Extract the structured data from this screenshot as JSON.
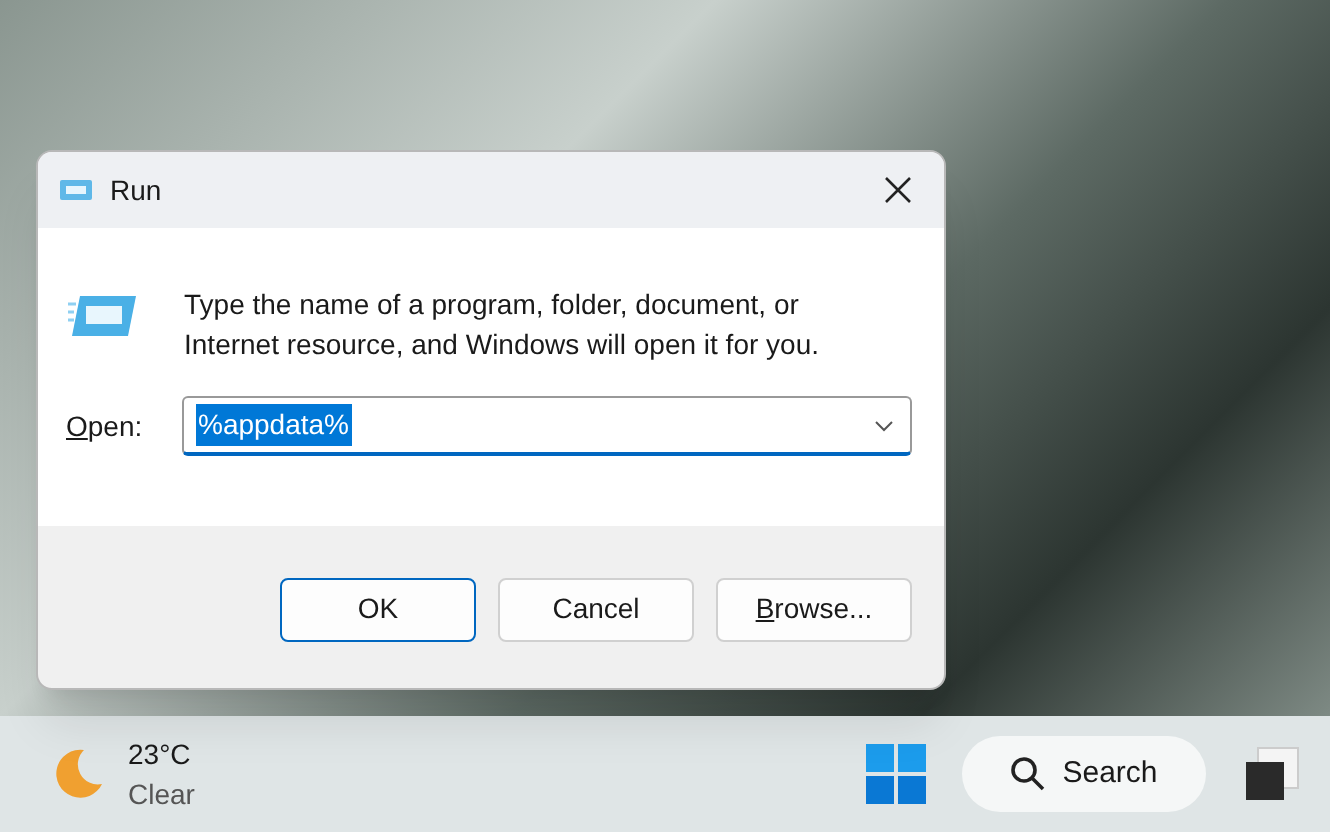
{
  "dialog": {
    "title": "Run",
    "message": "Type the name of a program, folder, document, or Internet resource, and Windows will open it for you.",
    "open_field": {
      "label": "Open:",
      "access_key": true,
      "value": "%appdata%",
      "selected_text": true
    },
    "buttons": [
      {
        "label": "OK",
        "default": true,
        "access_key": false
      },
      {
        "label": "Cancel",
        "default": false,
        "access_key": false
      },
      {
        "label": "Browse...",
        "default": false,
        "access_key": true
      }
    ]
  },
  "taskbar": {
    "weather": {
      "temperature": "23°C",
      "condition": "Clear"
    },
    "search": {
      "label": "Search"
    }
  }
}
